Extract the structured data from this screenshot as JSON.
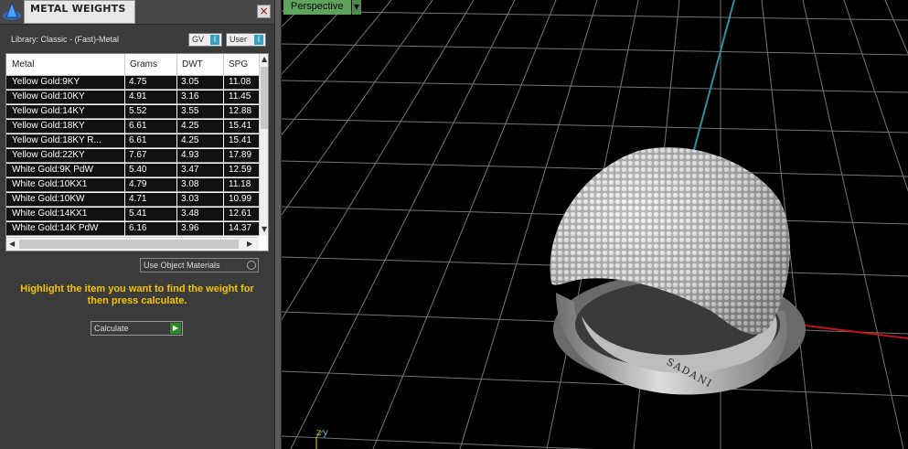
{
  "panel": {
    "title": "METAL WEIGHTS",
    "close_label": "×",
    "library_label": "Library: Classic - (Fast)-Metal",
    "toggles": [
      {
        "label": "GV",
        "knob": "I"
      },
      {
        "label": "User",
        "knob": "I"
      }
    ]
  },
  "table": {
    "headers": [
      "Metal",
      "Grams",
      "DWT",
      "SPG"
    ],
    "rows": [
      {
        "metal": "Yellow Gold:9KY",
        "grams": "4.75",
        "dwt": "3.05",
        "spg": "11.08"
      },
      {
        "metal": "Yellow Gold:10KY",
        "grams": "4.91",
        "dwt": "3.16",
        "spg": "11.45"
      },
      {
        "metal": "Yellow Gold:14KY",
        "grams": "5.52",
        "dwt": "3.55",
        "spg": "12.88"
      },
      {
        "metal": "Yellow Gold:18KY",
        "grams": "6.61",
        "dwt": "4.25",
        "spg": "15.41"
      },
      {
        "metal": "Yellow Gold:18KY R...",
        "grams": "6.61",
        "dwt": "4.25",
        "spg": "15.41"
      },
      {
        "metal": "Yellow Gold:22KY",
        "grams": "7.67",
        "dwt": "4.93",
        "spg": "17.89"
      },
      {
        "metal": "White Gold:9K PdW",
        "grams": "5.40",
        "dwt": "3.47",
        "spg": "12.59"
      },
      {
        "metal": "White Gold:10KX1",
        "grams": "4.79",
        "dwt": "3.08",
        "spg": "11.18"
      },
      {
        "metal": "White Gold:10KW",
        "grams": "4.71",
        "dwt": "3.03",
        "spg": "10.99"
      },
      {
        "metal": "White Gold:14KX1",
        "grams": "5.41",
        "dwt": "3.48",
        "spg": "12.61"
      },
      {
        "metal": "White Gold:14K PdW",
        "grams": "6.16",
        "dwt": "3.96",
        "spg": "14.37"
      }
    ]
  },
  "options": {
    "use_object_materials": "Use Object Materials",
    "hint": "Highlight the item you want to find the weight for then press calculate.",
    "calculate_label": "Calculate"
  },
  "viewport": {
    "view_name": "Perspective",
    "engraving": "SADANI",
    "axis_label_z": "z",
    "axis_label_y": "y",
    "colors": {
      "grid": "#8a8a8a",
      "x_axis": "#c0141b",
      "y_axis": "#2f8f9d",
      "panel_bg": "#3b3b3b",
      "hint": "#f5c400",
      "view_tab": "#5fa35f"
    }
  }
}
